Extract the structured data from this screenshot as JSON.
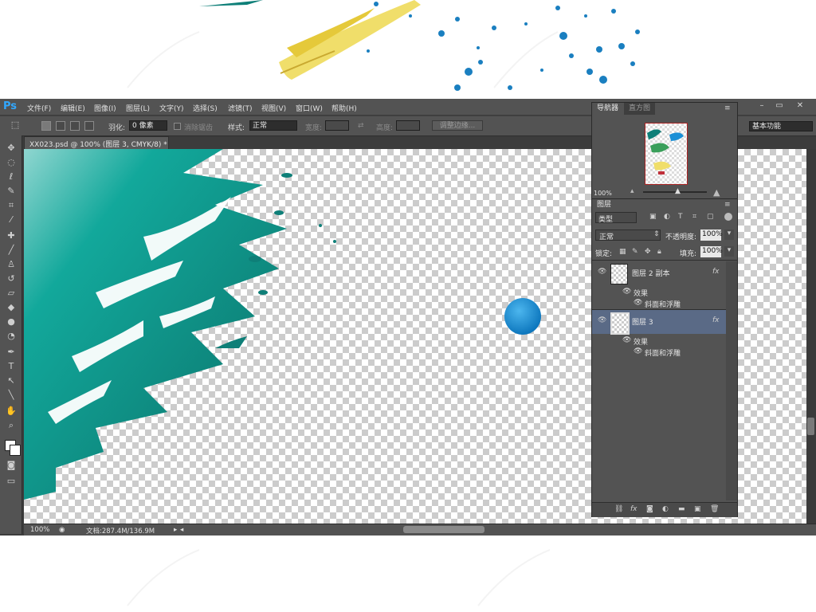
{
  "app": {
    "logo": "Ps",
    "menus": [
      "文件(F)",
      "编辑(E)",
      "图像(I)",
      "图层(L)",
      "文字(Y)",
      "选择(S)",
      "滤镜(T)",
      "视图(V)",
      "窗口(W)",
      "帮助(H)"
    ],
    "window_buttons": [
      "–",
      "▭",
      "✕"
    ]
  },
  "options": {
    "feather_label": "羽化:",
    "feather_value": "0 像素",
    "antialias_label": "消除锯齿",
    "style_label": "样式:",
    "style_value": "正常",
    "width_label": "宽度:",
    "height_label": "高度:",
    "refine_edge": "调整边缘...",
    "workspace": "基本功能"
  },
  "document": {
    "tab_title": "XX023.psd @ 100% (图层 3, CMYK/8) *"
  },
  "status": {
    "zoom": "100%",
    "doc_size": "文档:287.4M/136.9M"
  },
  "navigator": {
    "tab_active": "导航器",
    "tab_inactive": "直方图",
    "zoom": "100%"
  },
  "layers": {
    "tab": "图层",
    "filter_kind": "类型",
    "blend_mode": "正常",
    "opacity_label": "不透明度:",
    "opacity_value": "100%",
    "lock_label": "锁定:",
    "fill_label": "填充:",
    "fill_value": "100%",
    "items": [
      {
        "name": "图层 2 副本",
        "effects_label": "效果",
        "effect": "斜面和浮雕",
        "fx": "fx"
      },
      {
        "name": "图层 3",
        "effects_label": "效果",
        "effect": "斜面和浮雕",
        "fx": "fx"
      }
    ]
  },
  "colors": {
    "teal": "#0e7f78",
    "blue_ball": "#1a8fd6",
    "yellow": "#f2e27a",
    "selected_layer": "#5a6a86"
  }
}
